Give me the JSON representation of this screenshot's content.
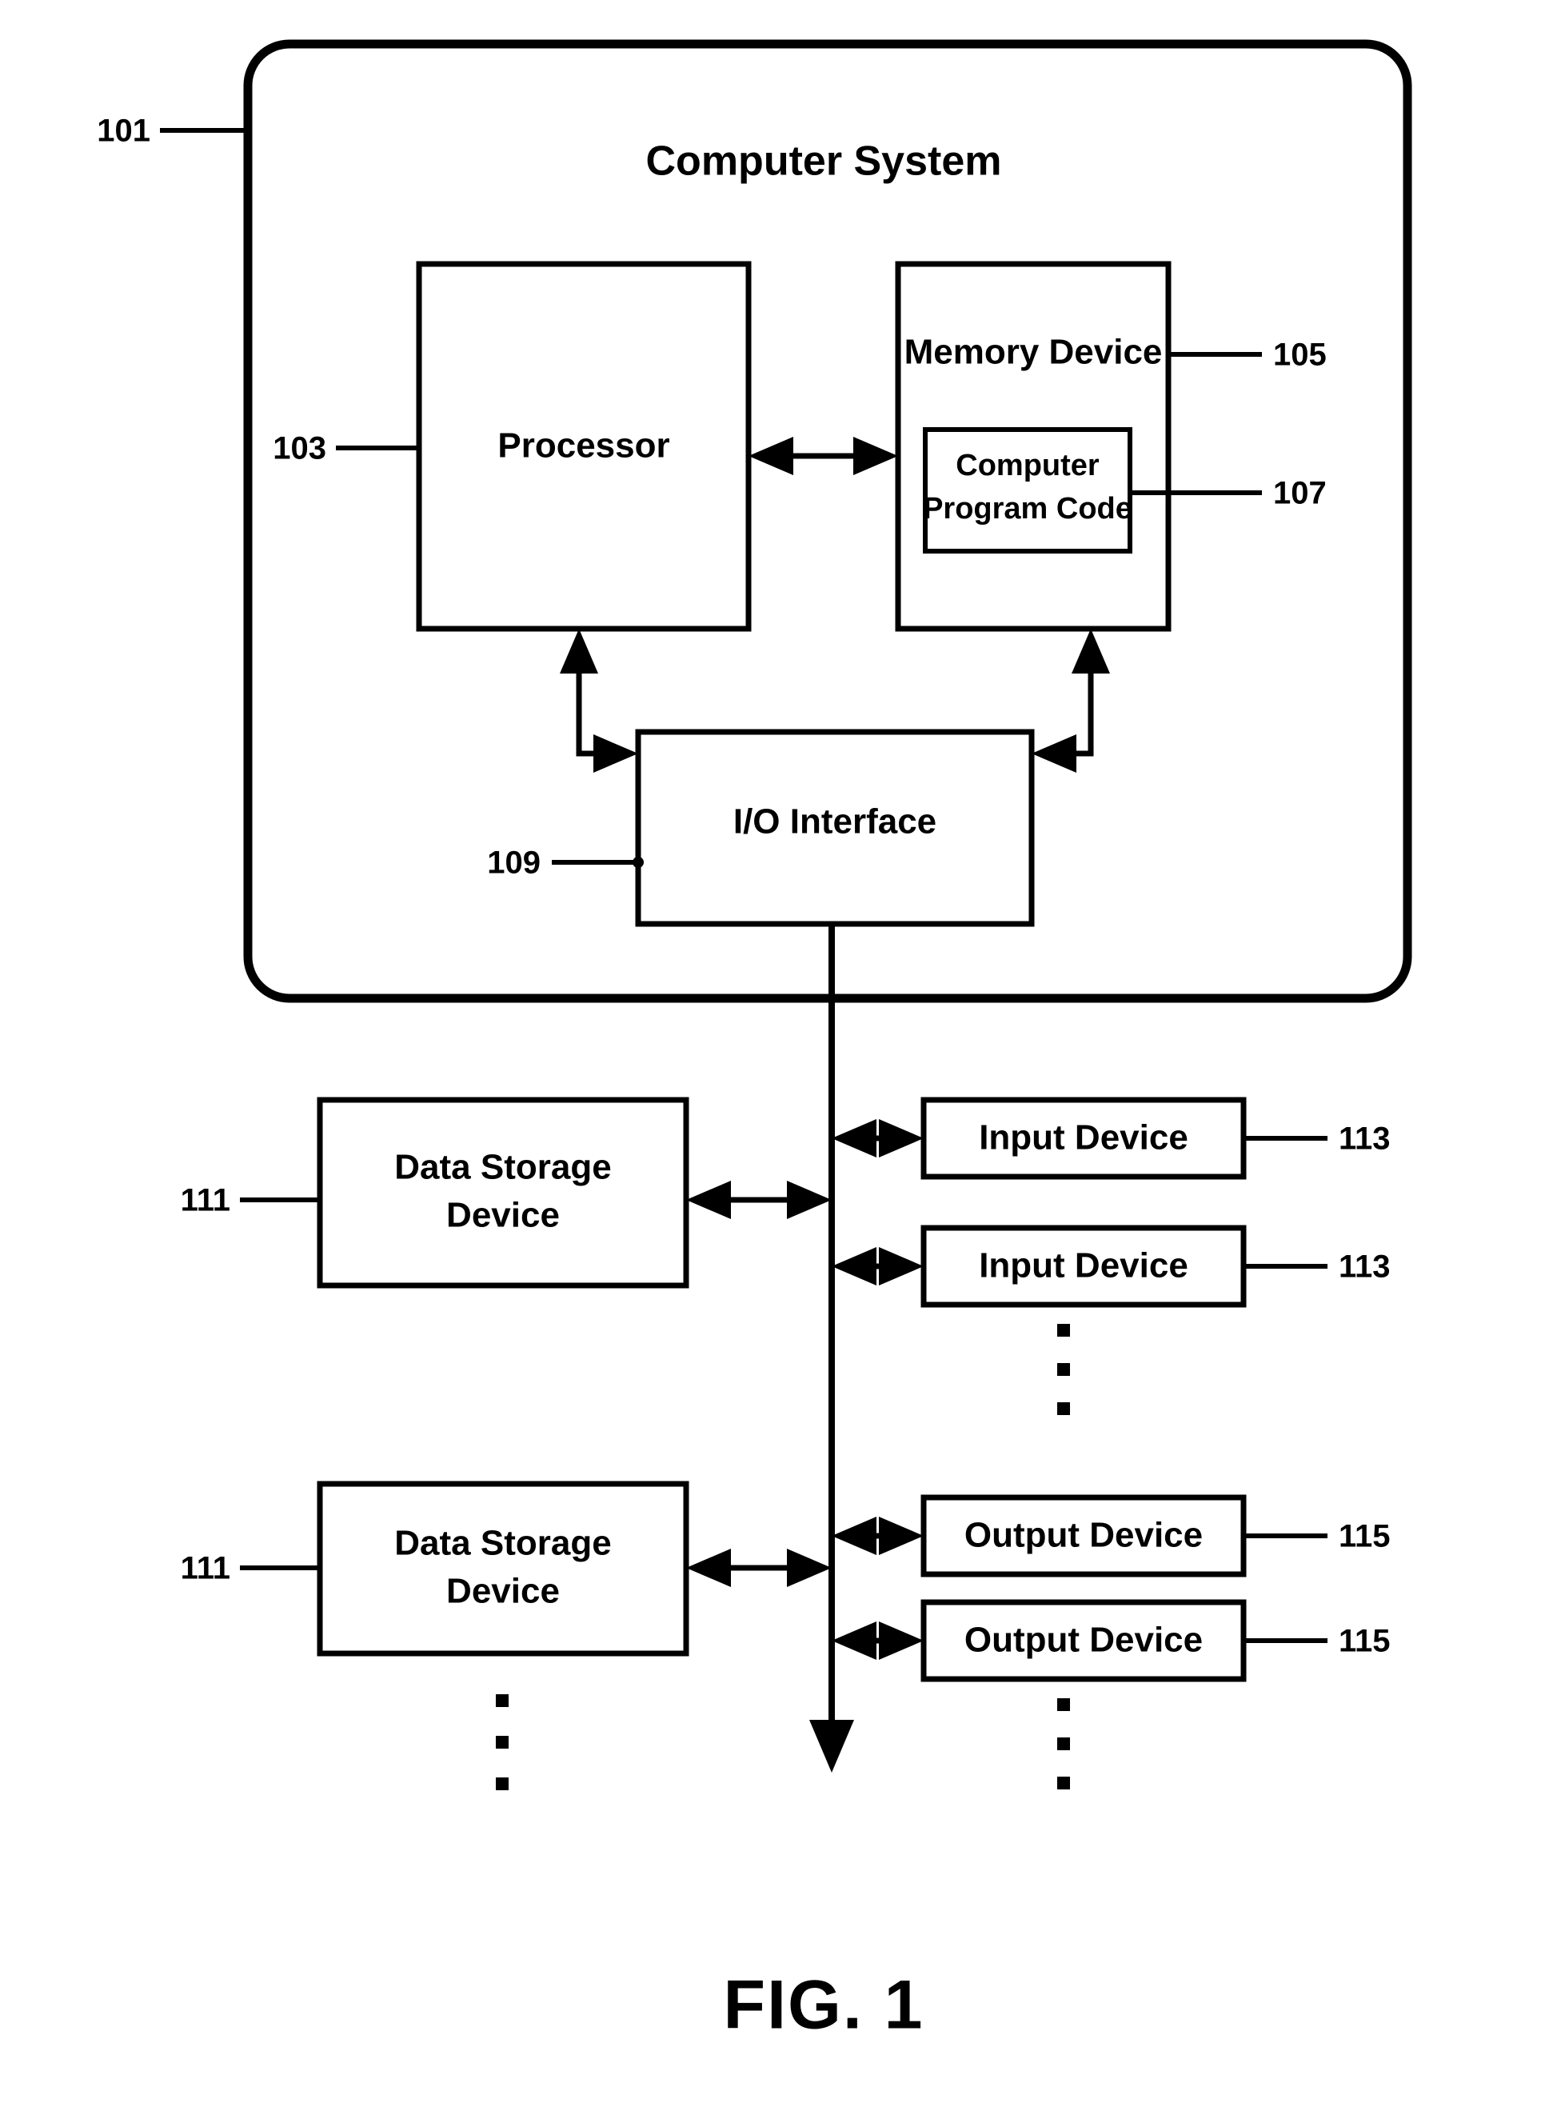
{
  "figure": {
    "caption": "FIG. 1",
    "title": "Computer System"
  },
  "reference_numerals": {
    "system": "101",
    "processor": "103",
    "memory_device": "105",
    "computer_program_code": "107",
    "io_interface": "109",
    "data_storage_device_1": "111",
    "data_storage_device_2": "111",
    "input_device_1": "113",
    "input_device_2": "113",
    "output_device_1": "115",
    "output_device_2": "115"
  },
  "blocks": {
    "processor": {
      "label": "Processor"
    },
    "memory_device": {
      "label": "Memory Device"
    },
    "computer_program_code": {
      "line1": "Computer",
      "line2": "Program Code"
    },
    "io_interface": {
      "label": "I/O Interface"
    },
    "data_storage_device_1": {
      "line1": "Data Storage",
      "line2": "Device"
    },
    "data_storage_device_2": {
      "line1": "Data Storage",
      "line2": "Device"
    },
    "input_device_1": {
      "label": "Input Device"
    },
    "input_device_2": {
      "label": "Input Device"
    },
    "output_device_1": {
      "label": "Output Device"
    },
    "output_device_2": {
      "label": "Output Device"
    }
  },
  "ellipses": {
    "input_devices": "⋮",
    "output_devices": "⋮",
    "data_storage_devices": "⋮"
  },
  "colors": {
    "stroke": "#000000",
    "fill": "#ffffff",
    "text": "#000000"
  }
}
